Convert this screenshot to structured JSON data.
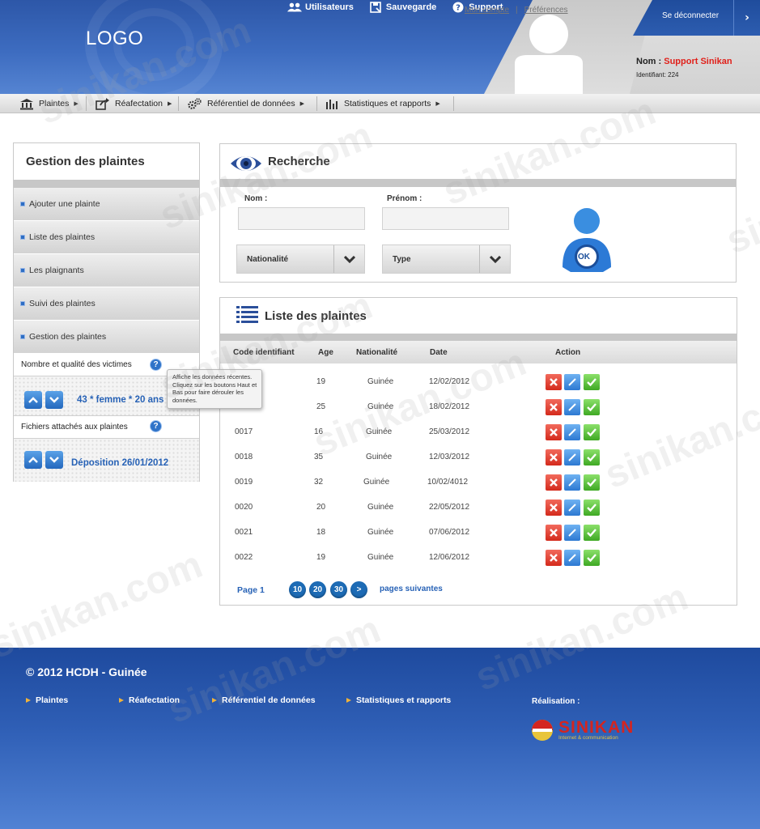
{
  "header": {
    "logo": "LOGO",
    "topnav": [
      {
        "label": "Utilisateurs",
        "icon": "users-icon"
      },
      {
        "label": "Sauvegarde",
        "icon": "save-icon"
      },
      {
        "label": "Support",
        "icon": "help-icon"
      }
    ],
    "logout_label": "Se déconnecter",
    "logout_arrow": "›",
    "user": {
      "name_label": "Nom :",
      "name_value": "Support Sinikan",
      "id_label": "Identifiant: 224"
    }
  },
  "menu": {
    "items": [
      {
        "label": "Plaintes",
        "icon": "bank-icon"
      },
      {
        "label": "Réafectation",
        "icon": "export-icon"
      },
      {
        "label": "Référentiel de données",
        "icon": "gears-icon"
      },
      {
        "label": "Statistiques et rapports",
        "icon": "bar-chart-icon"
      }
    ],
    "links": {
      "account": "Mon compte",
      "separator": "|",
      "preferences": "Préférences"
    }
  },
  "sidebar": {
    "title": "Gestion des plaintes",
    "items": [
      {
        "label": "Ajouter une plainte"
      },
      {
        "label": "Liste des plaintes"
      },
      {
        "label": "Les plaignants"
      },
      {
        "label": "Suivi des plaintes"
      },
      {
        "label": "Gestion des plaintes"
      }
    ],
    "victims": {
      "title": "Nombre et qualité des victimes",
      "value": "43 * femme * 20 ans"
    },
    "files": {
      "title": "Fichiers attachés aux plaintes",
      "value": "Déposition 26/01/2012"
    },
    "help_glyph": "?",
    "tooltip": "Affiche les données récentes. Cliquez sur les boutons Haut et Bas pour faire dérouler les données."
  },
  "search": {
    "title": "Recherche",
    "nom_label": "Nom :",
    "prenom_label": "Prénom :",
    "nom_value": "",
    "prenom_value": "",
    "nationalite_label": "Nationalité",
    "type_label": "Type",
    "ok_label": "OK"
  },
  "list": {
    "title": "Liste des plaintes",
    "columns": [
      "Code identifiant",
      "Age",
      "Nationalité",
      "Date",
      "Action"
    ],
    "rows": [
      {
        "code": "",
        "age": "19",
        "nationality": "Guinée",
        "date": "12/02/2012"
      },
      {
        "code": "",
        "age": "25",
        "nationality": "Guinée",
        "date": "18/02/2012"
      },
      {
        "code": "0017",
        "age": "16",
        "nationality": "Guinée",
        "date": "25/03/2012"
      },
      {
        "code": "0018",
        "age": "35",
        "nationality": "Guinée",
        "date": "12/03/2012"
      },
      {
        "code": "0019",
        "age": "32",
        "nationality": "Guinée",
        "date": "10/02/4012"
      },
      {
        "code": "0020",
        "age": "20",
        "nationality": "Guinée",
        "date": "22/05/2012"
      },
      {
        "code": "0021",
        "age": "18",
        "nationality": "Guinée",
        "date": "07/06/2012"
      },
      {
        "code": "0022",
        "age": "19",
        "nationality": "Guinée",
        "date": "12/06/2012"
      }
    ],
    "pagination": {
      "page_label": "Page 1",
      "pages": [
        "10",
        "20",
        "30",
        ">"
      ],
      "next_label": "pages suivantes"
    }
  },
  "footer": {
    "copyright_symbol": "©",
    "copyright": "2012 HCDH - Guinée",
    "links": [
      "Plaintes",
      "Réafectation",
      "Référentiel de données",
      "Statistiques et rapports"
    ],
    "realisation_label": "Réalisation :",
    "brand": "SINIKAN",
    "brand_tagline": "Internet & communication"
  },
  "watermark": "sinikan.com",
  "colors": {
    "header_blue": "#3d6cc0",
    "accent_red": "#e0201a",
    "link_blue": "#2762b6",
    "delete_red": "#d42a1c",
    "edit_blue": "#2d79d2",
    "validate_green": "#3fa924"
  }
}
